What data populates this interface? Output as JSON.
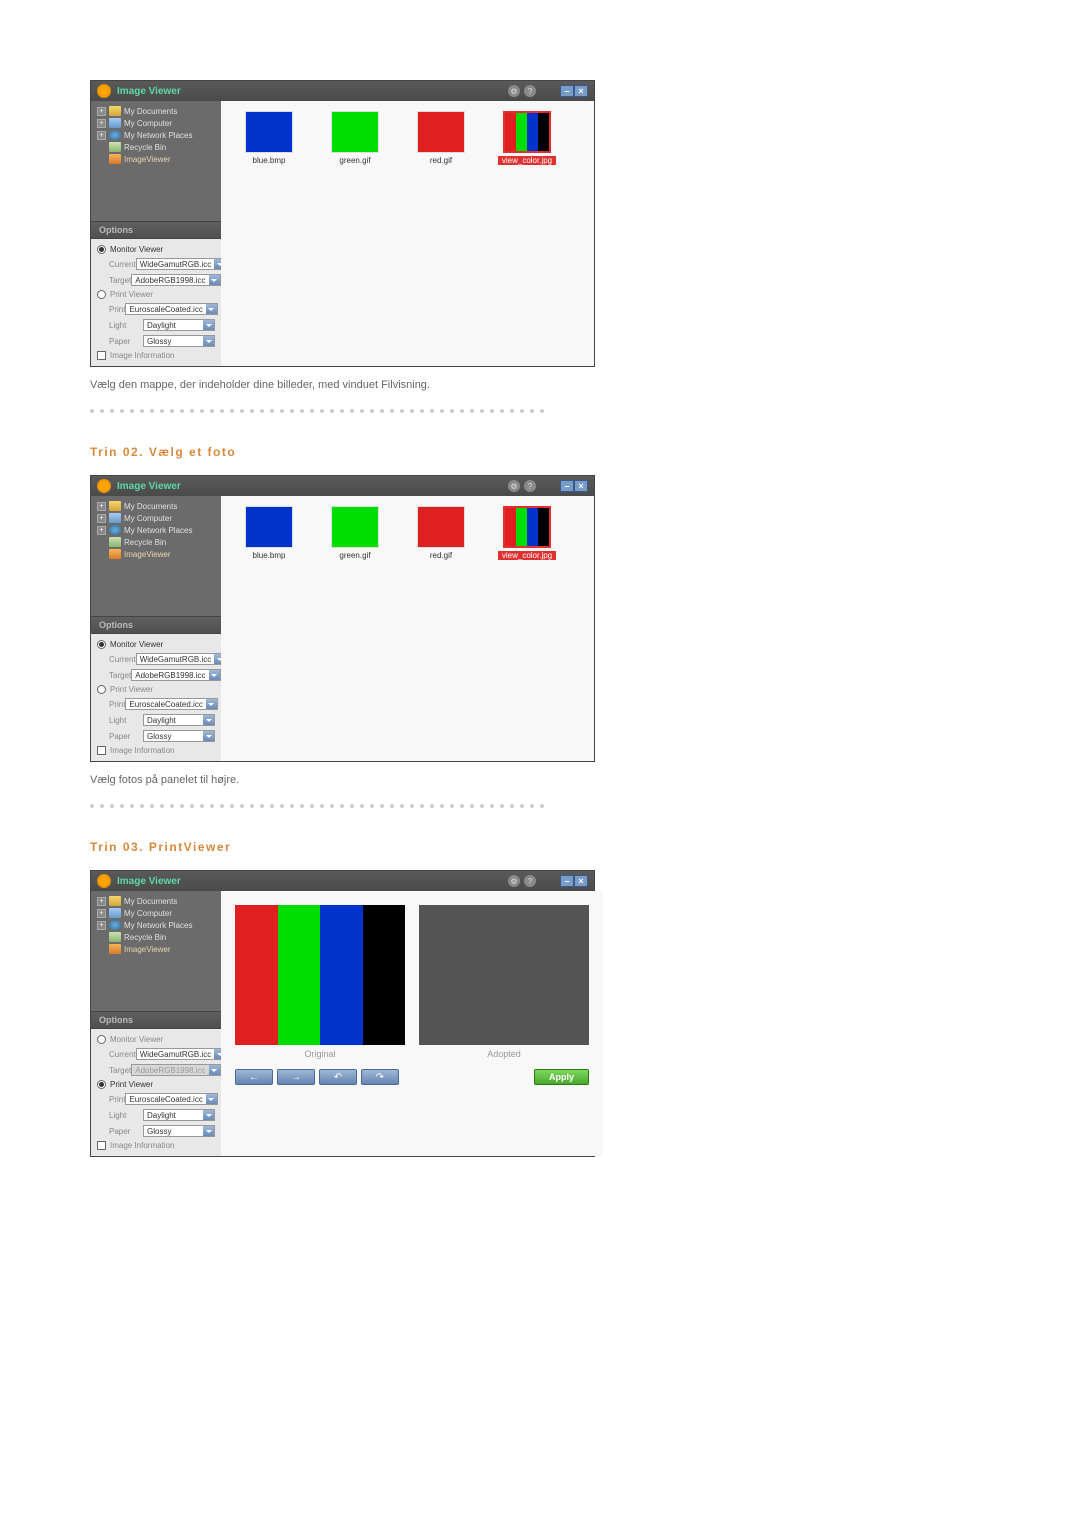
{
  "window": {
    "title": "Image Viewer",
    "help_icon": "?",
    "gear_icon": "⚙",
    "minimize": "–",
    "close": "×"
  },
  "tree": [
    {
      "label": "My Documents",
      "icon": "folder",
      "expandable": true
    },
    {
      "label": "My Computer",
      "icon": "computer",
      "expandable": true
    },
    {
      "label": "My Network Places",
      "icon": "network",
      "expandable": true
    },
    {
      "label": "Recycle Bin",
      "icon": "recycle",
      "expandable": false
    },
    {
      "label": "ImageViewer",
      "icon": "app",
      "expandable": false,
      "selected": true
    }
  ],
  "options": {
    "header": "Options",
    "monitor_label": "Monitor Viewer",
    "print_label": "Print Viewer",
    "current_label": "Current",
    "target_label": "Target",
    "print_field_label": "Print",
    "light_label": "Light",
    "paper_label": "Paper",
    "image_info_label": "Image Information",
    "current_value": "WideGamutRGB.icc",
    "target_value": "AdobeRGB1998.icc",
    "print_value": "EuroscaleCoated.icc",
    "light_value": "Daylight",
    "paper_value": "Glossy"
  },
  "thumbs": [
    {
      "name": "blue.bmp",
      "kind": "blue"
    },
    {
      "name": "green.gif",
      "kind": "green"
    },
    {
      "name": "red.gif",
      "kind": "red"
    },
    {
      "name": "view_color.jpg",
      "kind": "bars",
      "selected": true
    }
  ],
  "captions": {
    "step01_caption": "Vælg den mappe, der indeholder dine billeder, med vinduet Filvisning.",
    "step02_title": "Trin 02. Vælg et foto",
    "step02_caption": "Vælg fotos på panelet til højre.",
    "step03_title": "Trin 03. PrintViewer"
  },
  "preview": {
    "original_label": "Original",
    "adopted_label": "Adopted",
    "apply_label": "Apply",
    "arrow_left": "←",
    "arrow_right": "→",
    "rotate_ccw": "↶",
    "rotate_cw": "↷"
  },
  "colors": {
    "bars": [
      "#e02020",
      "#00dd00",
      "#0033cc",
      "#000000"
    ],
    "bars_dark": [
      "#8a1212",
      "#009a00",
      "#002288",
      "#000000"
    ]
  }
}
